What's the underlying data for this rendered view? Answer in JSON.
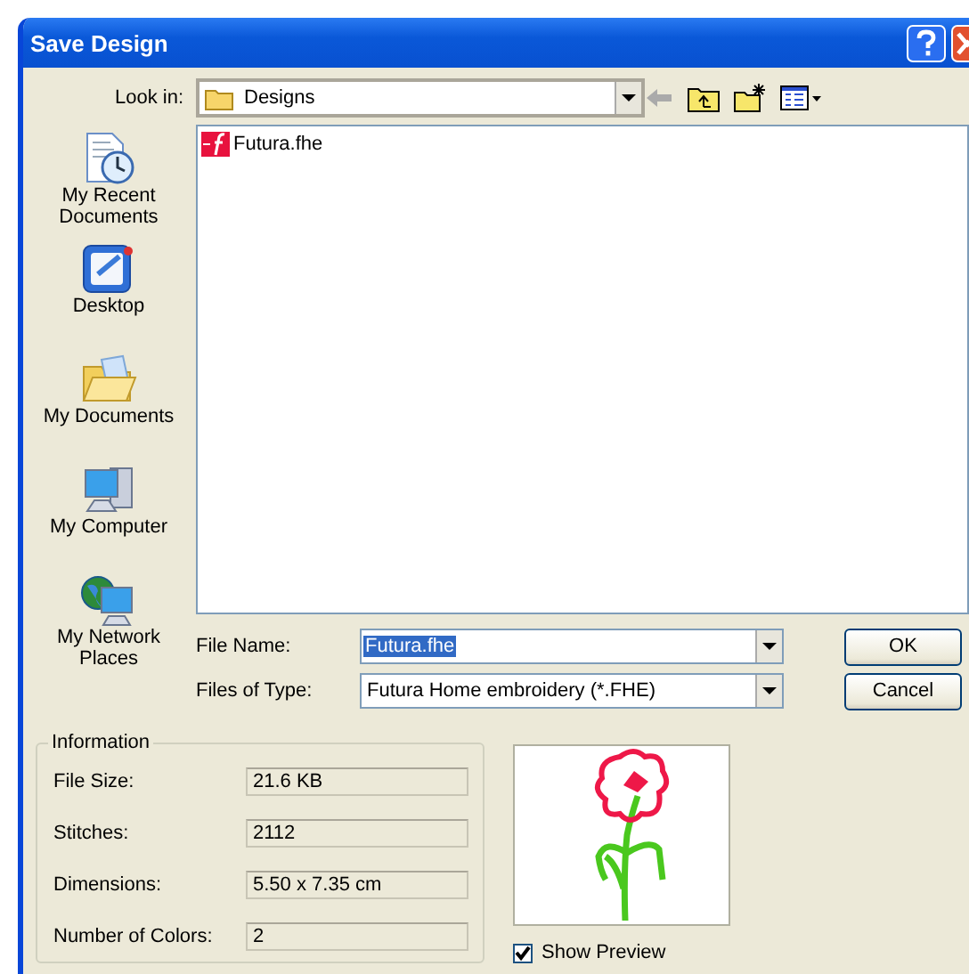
{
  "window": {
    "title": "Save Design"
  },
  "look_in": {
    "label": "Look in:",
    "value": "Designs"
  },
  "places": [
    {
      "label": "My Recent Documents",
      "kind": "recent"
    },
    {
      "label": "Desktop",
      "kind": "desktop"
    },
    {
      "label": "My Documents",
      "kind": "documents"
    },
    {
      "label": "My Computer",
      "kind": "computer"
    },
    {
      "label": "My Network Places",
      "kind": "network"
    }
  ],
  "files": [
    {
      "name": "Futura.fhe"
    }
  ],
  "file_name": {
    "label": "File Name:",
    "value": "Futura.fhe",
    "value_selected": true
  },
  "file_type": {
    "label": "Files of Type:",
    "value": "Futura Home embroidery (*.FHE)"
  },
  "buttons": [
    "OK",
    "Cancel"
  ],
  "information": {
    "title": "Information",
    "rows": [
      {
        "label": "File Size:",
        "value": "21.6 KB"
      },
      {
        "label": "Stitches:",
        "value": "2112"
      },
      {
        "label": "Dimensions:",
        "value": "5.50 x 7.35 cm"
      },
      {
        "label": "Number of Colors:",
        "value": "2"
      }
    ]
  },
  "show_preview": {
    "label": "Show Preview",
    "checked": true
  }
}
